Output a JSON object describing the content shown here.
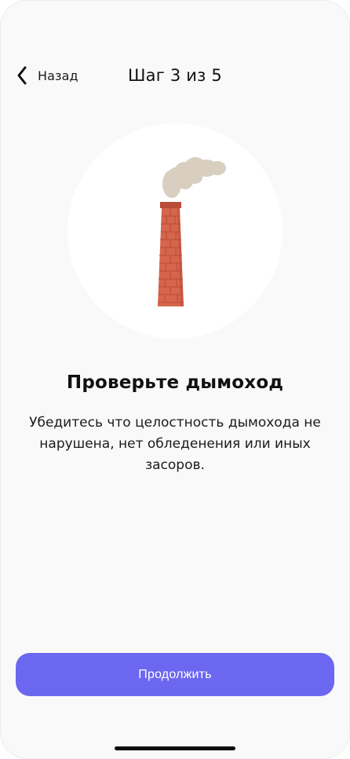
{
  "header": {
    "back_label": "Назад",
    "back_icon": "chevron-left-icon",
    "step_title": "Шаг 3 из 5"
  },
  "illustration": {
    "icon": "chimney-smoke-icon",
    "colors": {
      "circle": "#ffffff",
      "brick": "#d5654b",
      "brick_dark": "#b94c37",
      "smoke": "#d9cfc0"
    }
  },
  "content": {
    "headline": "Проверьте дымоход",
    "description": "Убедитесь что целостность дымохода не нарушена, нет обледенения или иных засоров."
  },
  "footer": {
    "continue_label": "Продолжить",
    "button_color": "#6b67f0"
  }
}
